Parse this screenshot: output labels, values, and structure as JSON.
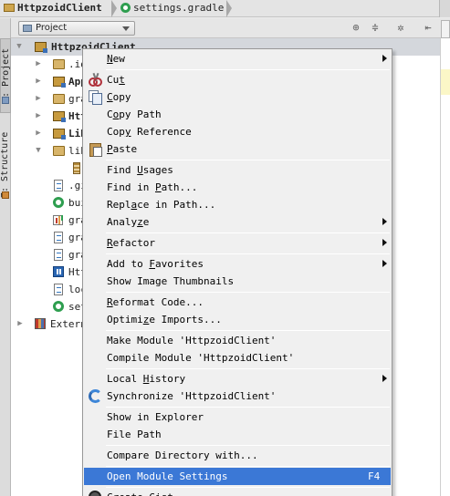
{
  "breadcrumb": {
    "items": [
      {
        "label": "HttpzoidClient",
        "icon": "folder-icon"
      },
      {
        "label": "settings.gradle",
        "icon": "gradle-icon"
      }
    ]
  },
  "tool_strip": {
    "project_tab": "1: Project",
    "structure_tab": "7: Structure"
  },
  "panel": {
    "view_selector": "Project",
    "toolbar_icons": [
      "target-icon",
      "collapse-icon",
      "gear-icon",
      "hide-icon"
    ]
  },
  "tree": {
    "root_label": "HttpzoidClient",
    "items": [
      {
        "label": ".id",
        "icon": "folder-icon"
      },
      {
        "label": "App",
        "icon": "module-icon"
      },
      {
        "label": "gra",
        "icon": "folder-icon"
      },
      {
        "label": "Htt",
        "icon": "module-icon"
      },
      {
        "label": "Lib",
        "icon": "module-icon"
      },
      {
        "label": "lib",
        "icon": "folder-icon"
      },
      {
        "label": "",
        "icon": "jar-icon"
      },
      {
        "label": ".gi",
        "icon": "file-icon"
      },
      {
        "label": "bui",
        "icon": "gradle-icon"
      },
      {
        "label": "gra",
        "icon": "chart-icon"
      },
      {
        "label": "gra",
        "icon": "file-icon"
      },
      {
        "label": "gra",
        "icon": "file-icon"
      },
      {
        "label": "Htt",
        "icon": "java-icon"
      },
      {
        "label": "loc",
        "icon": "file-icon"
      },
      {
        "label": "set",
        "icon": "gradle-icon"
      },
      {
        "label": "Extern",
        "icon": "library-icon"
      }
    ]
  },
  "menu": {
    "items": [
      {
        "label": "New",
        "accel": "N",
        "submenu": true
      },
      {
        "label": "Cut",
        "accel": "t",
        "icon": "cut-icon"
      },
      {
        "label": "Copy",
        "accel": "C",
        "icon": "copy-icon"
      },
      {
        "label": "Copy Path",
        "accel": "o"
      },
      {
        "label": "Copy Reference",
        "accel": "y"
      },
      {
        "label": "Paste",
        "accel": "P",
        "icon": "paste-icon"
      },
      {
        "label": "Find Usages",
        "accel": "U"
      },
      {
        "label": "Find in Path...",
        "accel": "P"
      },
      {
        "label": "Replace in Path...",
        "accel": "a"
      },
      {
        "label": "Analyze",
        "accel": "z",
        "submenu": true
      },
      {
        "label": "Refactor",
        "accel": "R",
        "submenu": true
      },
      {
        "label": "Add to Favorites",
        "accel": "F",
        "submenu": true
      },
      {
        "label": "Show Image Thumbnails"
      },
      {
        "label": "Reformat Code...",
        "accel": "R"
      },
      {
        "label": "Optimize Imports...",
        "accel": "z"
      },
      {
        "label": "Make Module 'HttpzoidClient'"
      },
      {
        "label": "Compile Module 'HttpzoidClient'"
      },
      {
        "label": "Local History",
        "accel": "H",
        "submenu": true
      },
      {
        "label": "Synchronize 'HttpzoidClient'",
        "icon": "sync-icon"
      },
      {
        "label": "Show in Explorer"
      },
      {
        "label": "File Path"
      },
      {
        "label": "Compare Directory with..."
      },
      {
        "label": "Open Module Settings",
        "shortcut": "F4",
        "highlighted": true
      },
      {
        "label": "Create Gist...",
        "icon": "github-icon"
      }
    ]
  },
  "colors": {
    "menu_highlight": "#3b78d6",
    "menu_background": "#f0f0f0",
    "tree_selection": "#d4d7dc"
  }
}
